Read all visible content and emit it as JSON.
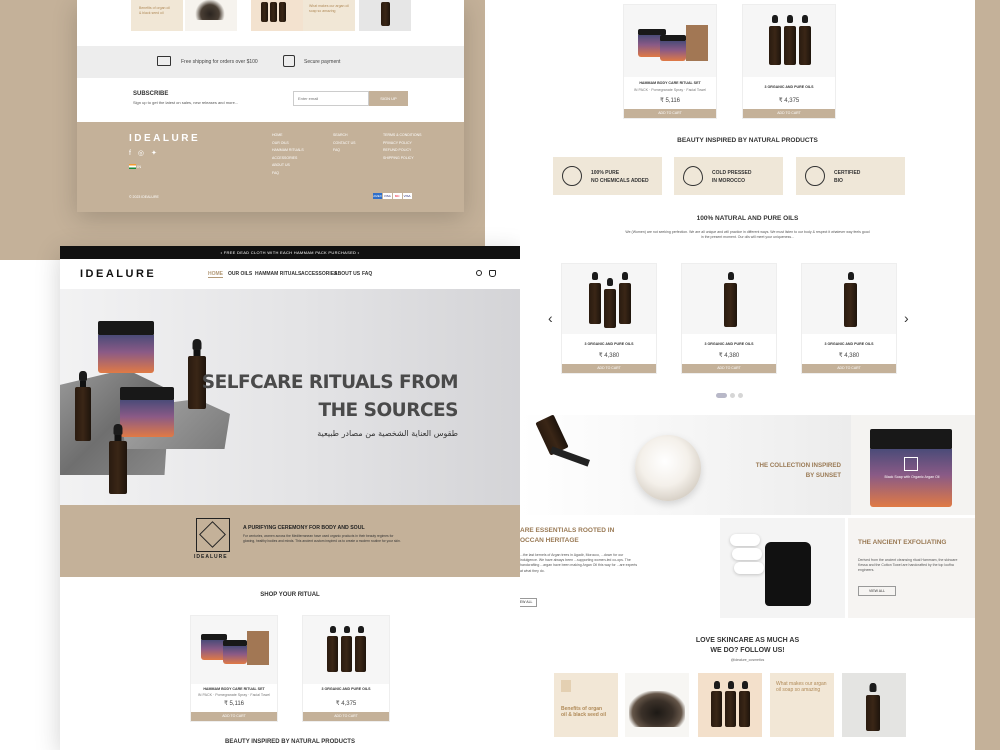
{
  "footer_panel": {
    "thumbs_text": {
      "thumb1": "Benefits of organ oil & black seed oil",
      "thumb2": "What makes our argan oil soap so amazing"
    },
    "shipping_text": "Free shipping for orders over $100",
    "secure_text": "Secure payment",
    "subscribe_title": "SUBSCRIBE",
    "subscribe_desc": "Sign up to get the latest on sales, new releases and more...",
    "email_placeholder": "Enter email",
    "signup_label": "SIGN UP",
    "brand": "IDEALURE",
    "country_code": "IN",
    "col1": [
      "HOME",
      "OUR OILS",
      "HAMMAM RITUALS",
      "ACCESSORIES",
      "ABOUT US",
      "FAQ"
    ],
    "col2": [
      "SEARCH",
      "CONTACT US",
      "FAQ"
    ],
    "col3": [
      "TERMS & CONDITIONS",
      "PRIVACY POLICY",
      "REFUND POLICY",
      "SHIPPING POLICY"
    ],
    "copyright": "© 2023 IDEALURE",
    "payments": [
      "AMEX",
      "VISA",
      "MC",
      "VISA"
    ]
  },
  "main_panel": {
    "topbar": "• FREE DEAD CLOTH WITH EACH HAMMAM PACK PURCHASED •",
    "brand": "IDEALURE",
    "nav": [
      "HOME",
      "OUR OILS",
      "HAMMAM RITUALS",
      "ACCESSORIES",
      "ABOUT US",
      "FAQ"
    ],
    "hero_title_line1": "SELFCARE RITUALS FROM",
    "hero_title_line2": "THE SOURCES",
    "hero_arabic": "طقوس العناية الشخصية من مصادر طبيعية",
    "ceremony_title": "A PURIFYING CEREMONY FOR BODY AND SOUL",
    "ceremony_text": "For centuries, women across the Mediterranean have used organic products in their beauty regimes for glowing, healthy bodies and minds. This ancient custom inspired us to create a modern routine for your skin.",
    "shop_title": "SHOP YOUR RITUAL",
    "beauty_title": "BEAUTY INSPIRED BY NATURAL PRODUCTS",
    "products": [
      {
        "name": "HAMMAM BODY CARE RITUAL SET",
        "sub": "IN PACK · Pomegranate Spray · Facial Towel",
        "price": "₹ 5,116",
        "button": "ADD TO CART"
      },
      {
        "name": "3 ORGANIC AND PURE OILS",
        "sub": "",
        "price": "₹ 4,375",
        "button": "ADD TO CART"
      }
    ]
  },
  "right_panel": {
    "products": [
      {
        "name": "HAMMAM BODY CARE RITUAL SET",
        "sub": "IN PACK · Pomegranate Spray · Facial Towel",
        "price": "₹ 5,116",
        "button": "ADD TO CART"
      },
      {
        "name": "3 ORGANIC AND PURE OILS",
        "price": "₹ 4,375",
        "button": "ADD TO CART"
      }
    ],
    "beauty_title": "BEAUTY INSPIRED BY NATURAL PRODUCTS",
    "features": [
      {
        "line1": "100% PURE",
        "line2": "NO CHEMICALS ADDED",
        "icon": "flask-icon"
      },
      {
        "line1": "COLD PRESSED",
        "line2": "IN MOROCCO",
        "icon": "drop-icon"
      },
      {
        "line1": "CERTIFIED",
        "line2": "BIO",
        "icon": "leaf-icon"
      }
    ],
    "oils_title": "100% NATURAL AND PURE OILS",
    "oils_desc": "We (Women) are not seeking perfection. We are all unique and will practice in different ways. We must listen to our body & respect it whatever way feels good in the present moment. Our oils will meet your uniqueness...",
    "carousel": [
      {
        "name": "3 ORGANIC AND PURE OILS",
        "price": "₹ 4,380",
        "button": "ADD TO CART"
      },
      {
        "name": "3 ORGANIC AND PURE OILS",
        "price": "₹ 4,380",
        "button": "ADD TO CART"
      },
      {
        "name": "3 ORGANIC AND PURE OILS",
        "price": "₹ 4,380",
        "button": "ADD TO CART"
      }
    ],
    "collection_title_1": "THE COLLECTION INSPIRED",
    "collection_title_2": "BY SUNSET",
    "jar_label": "Black Soap with Organic Argan Oil",
    "heritage_title_1": "ARE ESSENTIALS ROOTED IN",
    "heritage_title_2": "OCCAN HERITAGE",
    "heritage_text": "...the last kernels of Argan trees in Agadir, Morocco, ...down for our indulgence. We have always been ...supporting women-led co-ops. The handcrafting ...argan have been making Argan Oil this way for ...are experts at what they do.",
    "heritage_button": "VIEW ALL",
    "exfoliating_title": "THE ANCIENT EXFOLIATING",
    "exfoliating_text": "Derived from the ancient cleansing ritual Hammam, the skincare Kessa and the Cotton Towel are handcrafted by the top loofha engineers.",
    "exfoliating_button": "VIEW ALL",
    "follow_title_1": "LOVE SKINCARE AS MUCH AS",
    "follow_title_2": "WE DO? FOLLOW US!",
    "follow_handle": "@idealure_cosmetics",
    "insta_text_1": "Benefits of organ oil & black seed oil",
    "insta_text_2": "What makes our argan oil soap so amazing"
  },
  "colors": {
    "accent": "#c4b199",
    "feature_bg": "#efe7d8",
    "dark": "#111111"
  }
}
